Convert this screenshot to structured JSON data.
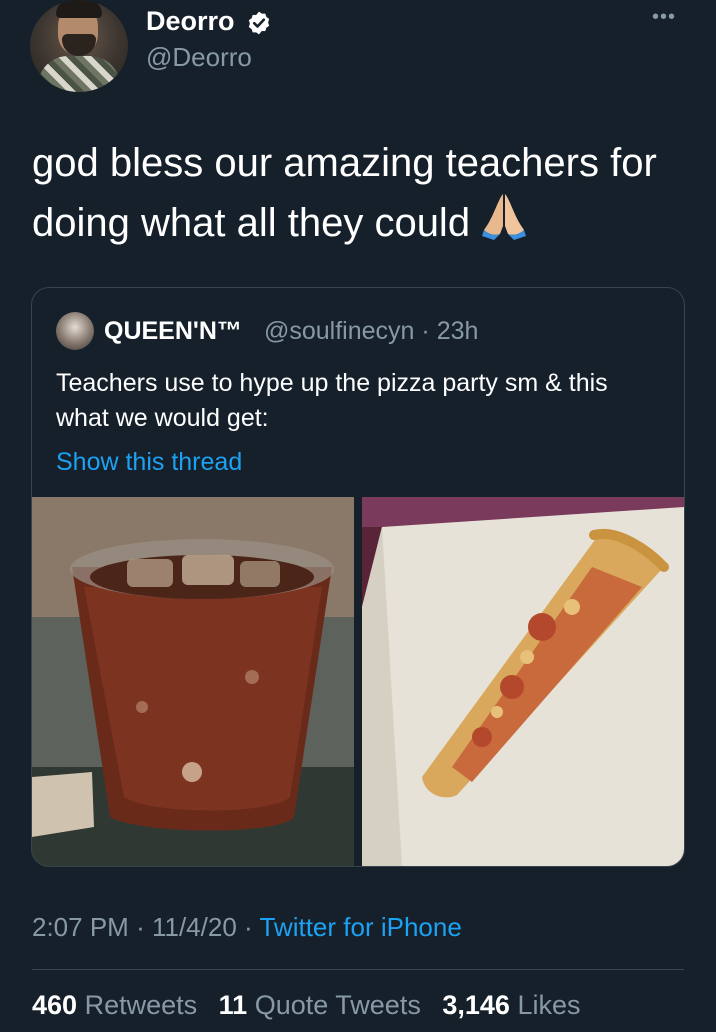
{
  "author": {
    "display_name": "Deorro",
    "handle": "@Deorro",
    "verified": true,
    "verified_icon": "verified-badge-icon"
  },
  "more_icon": "more-options-icon",
  "tweet": {
    "text": "god bless our amazing teachers for doing what all they could",
    "emoji_icon": "folded-hands-icon"
  },
  "quoted_tweet": {
    "display_name": "QUEEN'N™",
    "handle": "@soulfinecyn",
    "separator": "·",
    "time": "23h",
    "text": "Teachers use to hype up the pizza party sm & this what we would get:",
    "show_thread": "Show this thread",
    "images": [
      "cup-of-soda-image",
      "pizza-slice-image"
    ]
  },
  "meta": {
    "time": "2:07 PM",
    "sep1": "·",
    "date": "11/4/20",
    "sep2": "·",
    "source": "Twitter for iPhone"
  },
  "stats": {
    "retweets_count": "460",
    "retweets_label": "Retweets",
    "quotes_count": "11",
    "quotes_label": "Quote Tweets",
    "likes_count": "3,146",
    "likes_label": "Likes"
  },
  "colors": {
    "background": "#15202b",
    "accent": "#1da1f2",
    "muted": "#8899a6",
    "border": "#38444d"
  }
}
